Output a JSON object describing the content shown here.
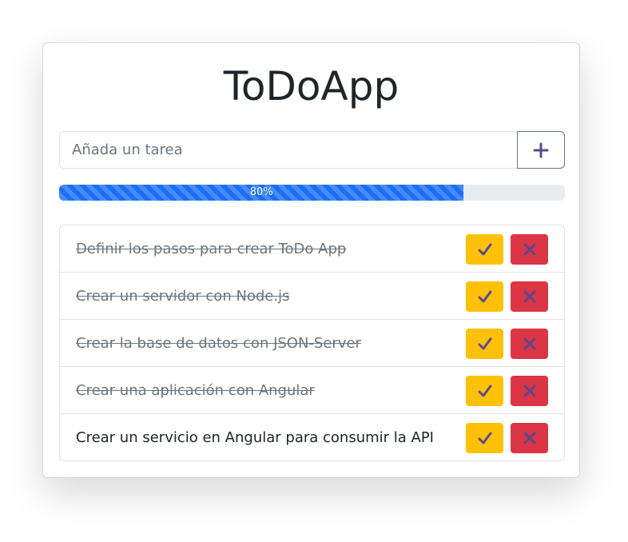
{
  "app": {
    "title": "ToDoApp"
  },
  "new_task": {
    "placeholder": "Añada un tarea",
    "value": "",
    "add_icon": "plus-icon"
  },
  "progress": {
    "value": 0.8,
    "label": "80%"
  },
  "tasks": [
    {
      "text": "Definir los pasos para crear ToDo App",
      "completed": true
    },
    {
      "text": "Crear un servidor con Node.js",
      "completed": true
    },
    {
      "text": "Crear la base de datos con JSON-Server",
      "completed": true
    },
    {
      "text": "Crear una aplicación con Angular",
      "completed": true
    },
    {
      "text": "Crear un servicio en Angular para consumir la API",
      "completed": false
    }
  ],
  "task_actions": {
    "complete_icon": "check-icon",
    "delete_icon": "x-icon"
  },
  "colors": {
    "accent": "#5b4a8b",
    "progress": "#1a6ef5",
    "complete_button": "#ffc107",
    "delete_button": "#dc3545",
    "text": "#212529",
    "muted_text": "#6c757d"
  }
}
